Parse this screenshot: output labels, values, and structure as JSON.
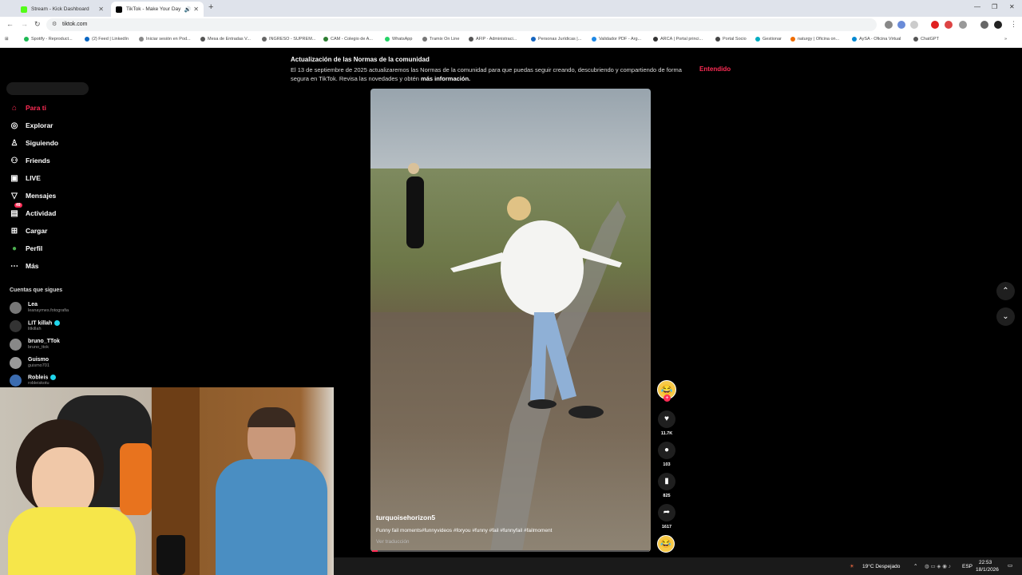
{
  "browser": {
    "tabs": [
      {
        "title": "Stream - Kick Dashboard",
        "active": false
      },
      {
        "title": "TikTok - Make Your Day",
        "active": true
      }
    ],
    "url": "tiktok.com",
    "bookmarks": [
      "Spotify - Reproduct...",
      "(2) Feed | LinkedIn",
      "Iniciar sesión en Pod...",
      "Mesa de Entradas V...",
      "INGRESO - SUPREM...",
      "CAM - Colegio de A...",
      "WhatsApp",
      "Tramix On Line",
      "AFIP - Administraci...",
      "Personas Jurídicas |...",
      "Validador PDF - Arg...",
      "ARCA | Portal princi...",
      "Portal Socio",
      "Gestionar",
      "naturgy | Oficina on...",
      "AySA - Oficina Virtual",
      "ChatGPT"
    ]
  },
  "sidebar": {
    "items": [
      {
        "label": "Para ti",
        "icon": "home-icon",
        "active": true
      },
      {
        "label": "Explorar",
        "icon": "compass-icon"
      },
      {
        "label": "Siguiendo",
        "icon": "following-icon"
      },
      {
        "label": "Friends",
        "icon": "friends-icon"
      },
      {
        "label": "LIVE",
        "icon": "live-icon"
      },
      {
        "label": "Mensajes",
        "icon": "messages-icon"
      },
      {
        "label": "Actividad",
        "icon": "activity-icon",
        "badge": "49"
      },
      {
        "label": "Cargar",
        "icon": "upload-icon"
      },
      {
        "label": "Perfil",
        "icon": "profile-icon"
      },
      {
        "label": "Más",
        "icon": "more-icon"
      }
    ],
    "following_title": "Cuentas que sigues",
    "following": [
      {
        "name": "Lea",
        "handle": "leanaymes.fotografia"
      },
      {
        "name": "LIT killah",
        "handle": "litkillah"
      },
      {
        "name": "bruno_TTok",
        "handle": "bruno_ttok"
      },
      {
        "name": "Guismo",
        "handle": "guismo701"
      },
      {
        "name": "Robleis",
        "handle": "robleiskotu"
      }
    ]
  },
  "banner": {
    "title": "Actualización de las Normas de la comunidad",
    "text": "El 13 de septiembre de 2025 actualizaremos las Normas de la comunidad para que puedas seguir creando, descubriendo y compartiendo de forma segura en TikTok. Revisa las novedades y obtén",
    "link": "más información.",
    "button": "Entendido"
  },
  "video": {
    "author": "turquoisehorizon5",
    "caption": "Funny fail moments#funnyvideos #foryou #funny #fail #funnyfail #failmoment",
    "translate": "Ver traducción",
    "progress": 0.02
  },
  "actions": {
    "likes": "11.7K",
    "comments": "103",
    "saves": "825",
    "shares": "1617"
  },
  "taskbar": {
    "weather": "19°C  Despejado",
    "lang": "ESP",
    "time": "22:53",
    "date": "18/1/2026"
  }
}
